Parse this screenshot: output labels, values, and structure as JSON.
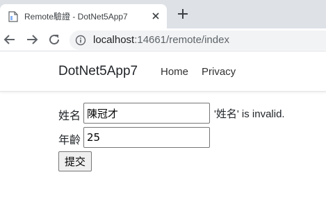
{
  "browser": {
    "tab_title": "Remote驗證 - DotNet5App7",
    "url_host": "localhost",
    "url_rest": ":14661/remote/index"
  },
  "navbar": {
    "brand": "DotNet5App7",
    "links": [
      "Home",
      "Privacy"
    ]
  },
  "form": {
    "name_label": "姓名",
    "name_value": "陳冠才",
    "name_error": "'姓名' is invalid.",
    "age_label": "年齡",
    "age_value": "25",
    "submit_label": "提交"
  },
  "colors": {
    "tabstrip": "#dee1e6",
    "omnibox": "#f1f3f4",
    "text": "#212529"
  }
}
